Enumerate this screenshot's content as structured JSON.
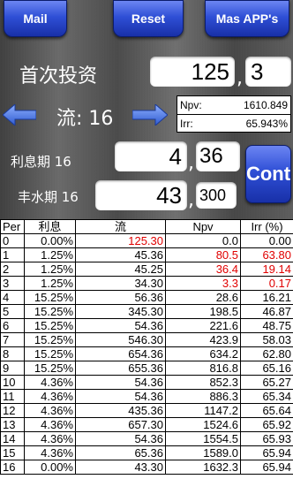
{
  "toolbar": {
    "mail_label": "Mail",
    "reset_label": "Reset",
    "apps_label": "Mas APP's"
  },
  "investment": {
    "label": "首次投资",
    "amount": "125",
    "periods": "3"
  },
  "flow": {
    "label": "流: 16"
  },
  "results": {
    "npv_label": "Npv:",
    "npv_value": "1610.849",
    "irr_label": "Irr:",
    "irr_value": "65.943%"
  },
  "interest": {
    "label": "利息期 16",
    "value": "4",
    "periods": "36"
  },
  "abundance": {
    "label": "丰水期 16",
    "value": "43",
    "periods": "300"
  },
  "cont_label": "Cont",
  "table": {
    "headers": {
      "per": "Per",
      "interest": "利息",
      "flow": "流",
      "npv": "Npv",
      "irr": "Irr (%)"
    },
    "rows": [
      {
        "per": "0",
        "interest": "0.00%",
        "flow": "125.30",
        "npv": "0.0",
        "irr": "0.00",
        "flow_red": true,
        "npv_red": false,
        "irr_red": false
      },
      {
        "per": "1",
        "interest": "1.25%",
        "flow": "45.36",
        "npv": "80.5",
        "irr": "63.80",
        "flow_red": false,
        "npv_red": true,
        "irr_red": true
      },
      {
        "per": "2",
        "interest": "1.25%",
        "flow": "45.25",
        "npv": "36.4",
        "irr": "19.14",
        "flow_red": false,
        "npv_red": true,
        "irr_red": true
      },
      {
        "per": "3",
        "interest": "1.25%",
        "flow": "34.30",
        "npv": "3.3",
        "irr": "0.17",
        "flow_red": false,
        "npv_red": true,
        "irr_red": true
      },
      {
        "per": "4",
        "interest": "15.25%",
        "flow": "56.36",
        "npv": "28.6",
        "irr": "16.21",
        "flow_red": false,
        "npv_red": false,
        "irr_red": false
      },
      {
        "per": "5",
        "interest": "15.25%",
        "flow": "345.30",
        "npv": "198.5",
        "irr": "46.87",
        "flow_red": false,
        "npv_red": false,
        "irr_red": false
      },
      {
        "per": "6",
        "interest": "15.25%",
        "flow": "54.36",
        "npv": "221.6",
        "irr": "48.75",
        "flow_red": false,
        "npv_red": false,
        "irr_red": false
      },
      {
        "per": "7",
        "interest": "15.25%",
        "flow": "546.30",
        "npv": "423.9",
        "irr": "58.03",
        "flow_red": false,
        "npv_red": false,
        "irr_red": false
      },
      {
        "per": "8",
        "interest": "15.25%",
        "flow": "654.36",
        "npv": "634.2",
        "irr": "62.80",
        "flow_red": false,
        "npv_red": false,
        "irr_red": false
      },
      {
        "per": "9",
        "interest": "15.25%",
        "flow": "655.36",
        "npv": "816.8",
        "irr": "65.16",
        "flow_red": false,
        "npv_red": false,
        "irr_red": false
      },
      {
        "per": "10",
        "interest": "4.36%",
        "flow": "54.36",
        "npv": "852.3",
        "irr": "65.27",
        "flow_red": false,
        "npv_red": false,
        "irr_red": false
      },
      {
        "per": "11",
        "interest": "4.36%",
        "flow": "54.36",
        "npv": "886.3",
        "irr": "65.34",
        "flow_red": false,
        "npv_red": false,
        "irr_red": false
      },
      {
        "per": "12",
        "interest": "4.36%",
        "flow": "435.36",
        "npv": "1147.2",
        "irr": "65.64",
        "flow_red": false,
        "npv_red": false,
        "irr_red": false
      },
      {
        "per": "13",
        "interest": "4.36%",
        "flow": "657.30",
        "npv": "1524.6",
        "irr": "65.92",
        "flow_red": false,
        "npv_red": false,
        "irr_red": false
      },
      {
        "per": "14",
        "interest": "4.36%",
        "flow": "54.36",
        "npv": "1554.5",
        "irr": "65.93",
        "flow_red": false,
        "npv_red": false,
        "irr_red": false
      },
      {
        "per": "15",
        "interest": "4.36%",
        "flow": "65.36",
        "npv": "1589.0",
        "irr": "65.94",
        "flow_red": false,
        "npv_red": false,
        "irr_red": false
      },
      {
        "per": "16",
        "interest": "0.00%",
        "flow": "43.30",
        "npv": "1632.3",
        "irr": "65.94",
        "flow_red": false,
        "npv_red": false,
        "irr_red": false
      }
    ]
  },
  "colors": {
    "button_blue": "#2f4fd6",
    "arrow_blue": "#4a78e0",
    "negative_red": "#e00000"
  }
}
